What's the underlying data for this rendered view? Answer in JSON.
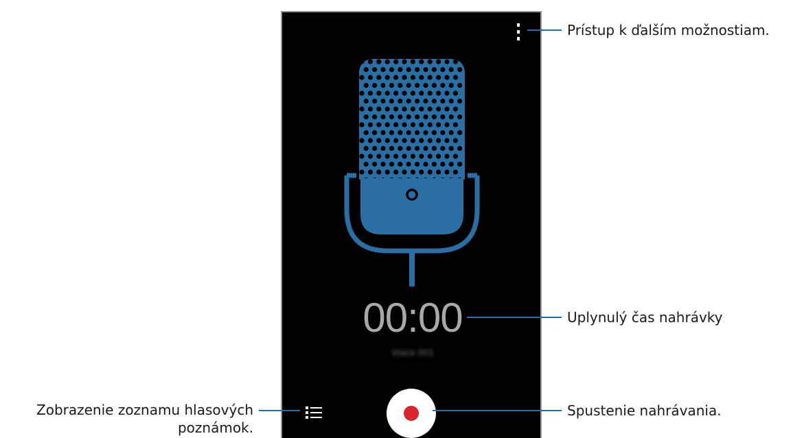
{
  "screen": {
    "timer": "00:00",
    "recording_name": "Voice 001",
    "accent_color": "#2a6fa3",
    "record_color": "#d9262e",
    "timer_color": "#a8a8a8"
  },
  "icons": {
    "menu": "more-options-icon",
    "microphone": "microphone-icon",
    "list": "list-icon",
    "record": "record-icon"
  },
  "callouts": {
    "more_options": "Prístup k ďalším možnostiam.",
    "elapsed_time": "Uplynulý čas nahrávky",
    "start_recording": "Spustenie nahrávania.",
    "voice_list_line1": "Zobrazenie zoznamu hlasových",
    "voice_list_line2": "poznámok."
  },
  "callout_color": "#1f6fae"
}
